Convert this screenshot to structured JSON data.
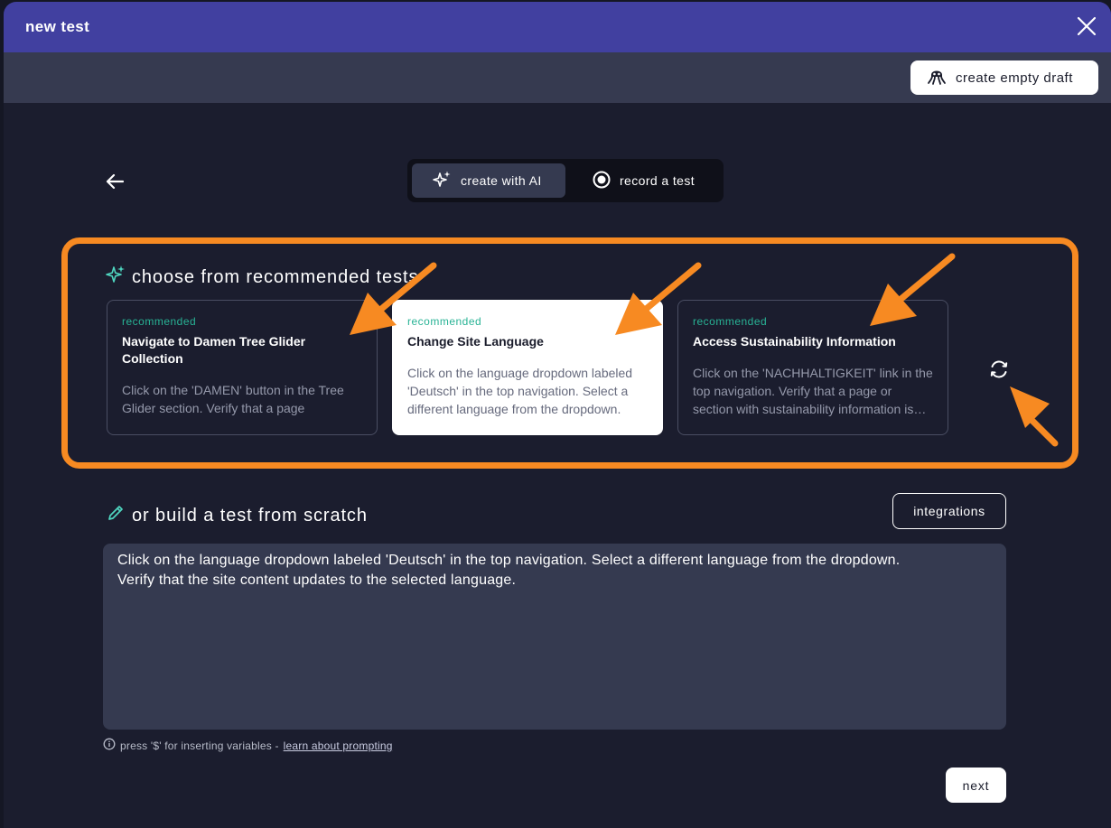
{
  "modal": {
    "title": "new test",
    "create_empty_draft_label": "create empty draft"
  },
  "mode_toggle": {
    "create_with_ai_label": "create with AI",
    "record_test_label": "record a test",
    "active": "create with AI"
  },
  "recommended": {
    "title": "choose from recommended tests",
    "cards": [
      {
        "badge": "recommended",
        "title": "Navigate to Damen Tree Glider Collection",
        "description": "Click on the 'DAMEN' button in the Tree Glider section. Verify that a page",
        "selected": false
      },
      {
        "badge": "recommended",
        "title": "Change Site Language",
        "description": "Click on the language dropdown labeled 'Deutsch' in the top navigation. Select a different language from the dropdown.",
        "selected": true
      },
      {
        "badge": "recommended",
        "title": "Access Sustainability Information",
        "description": "Click on the 'NACHHALTIGKEIT' link in the top navigation. Verify that a page or section with sustainability information is displayed.",
        "selected": false
      }
    ]
  },
  "scratch": {
    "title": "or build a test from scratch",
    "integrations_label": "integrations",
    "prompt_value": "Click on the language dropdown labeled 'Deutsch' in the top navigation. Select a different language from the dropdown.\nVerify that the site content updates to the selected language.",
    "hint_text": "press '$' for inserting variables - ",
    "hint_link": "learn about prompting"
  },
  "footer": {
    "next_label": "next"
  },
  "colors": {
    "titlebar": "#4140a0",
    "accent_orange": "#f78a22",
    "recommended_green": "#28b395",
    "panel": "#353a50",
    "background": "#1b1d2e"
  }
}
